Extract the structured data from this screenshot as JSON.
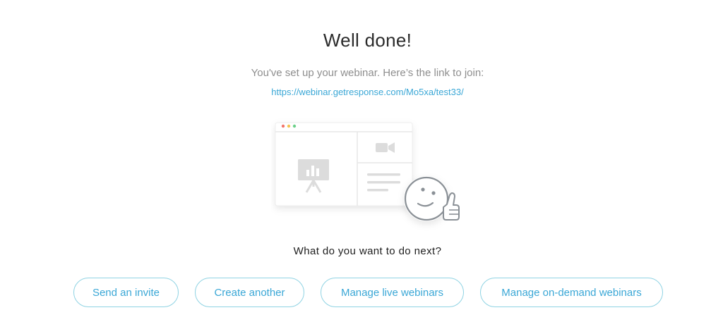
{
  "header": {
    "title": "Well done!",
    "subtitle": "You've set up your webinar. Here’s the link to join:",
    "link": "https://webinar.getresponse.com/Mo5xa/test33/"
  },
  "illustration": {
    "icons": [
      "presentation-board-icon",
      "video-camera-icon",
      "smiley-thumbs-up-icon"
    ],
    "window_dots": [
      "#f2766b",
      "#f5c451",
      "#6cd08a"
    ]
  },
  "next_steps": {
    "question": "What do you want to do next?",
    "buttons": {
      "invite": "Send an invite",
      "create": "Create another",
      "live": "Manage live webinars",
      "ondemand": "Manage on-demand webinars"
    }
  },
  "colors": {
    "accent": "#3aa7d6",
    "button_border": "#8fd3e3",
    "title": "#2b2b2b",
    "muted": "#8e8e8e"
  }
}
